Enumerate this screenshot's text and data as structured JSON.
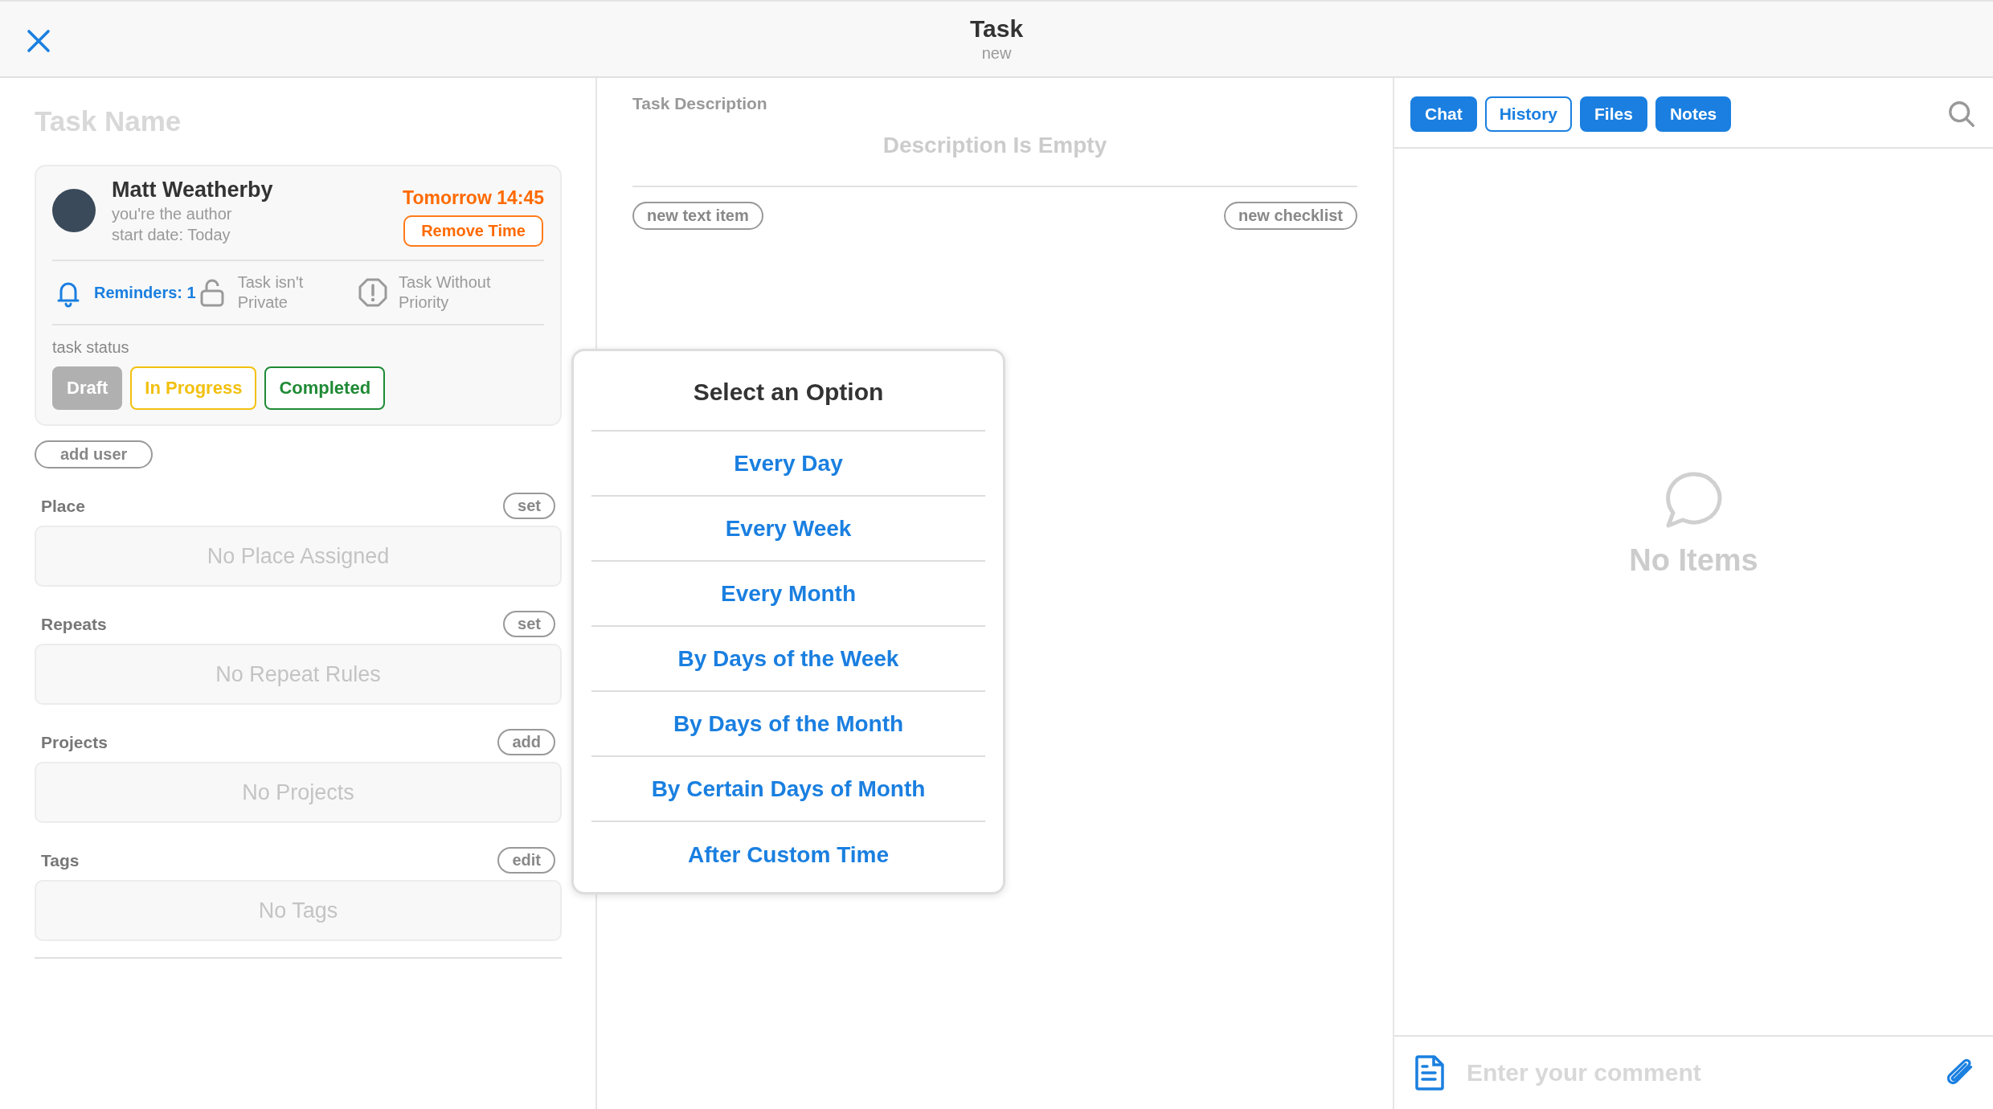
{
  "header": {
    "title": "Task",
    "subtitle": "new"
  },
  "task": {
    "name_placeholder": "Task Name",
    "author": {
      "name": "Matt Weatherby",
      "role": "you're the author",
      "start": "start date: Today"
    },
    "due": "Tomorrow 14:45",
    "remove_time": "Remove Time",
    "flags": [
      {
        "kind": "bell",
        "label": "Reminders: 1",
        "active": true
      },
      {
        "kind": "lock",
        "label": "Task isn't Private",
        "active": false
      },
      {
        "kind": "priority",
        "label": "Task Without Priority",
        "active": false
      }
    ],
    "status_label": "task status",
    "statuses": [
      {
        "label": "Draft",
        "selected": true,
        "color": "#b0b0b0"
      },
      {
        "label": "In Progress",
        "selected": false,
        "color": "#f2c00f"
      },
      {
        "label": "Completed",
        "selected": false,
        "color": "#1f8a35"
      }
    ],
    "add_user": "add user"
  },
  "sections": [
    {
      "label": "Place",
      "action": "set",
      "empty": "No Place Assigned"
    },
    {
      "label": "Repeats",
      "action": "set",
      "empty": "No Repeat Rules"
    },
    {
      "label": "Projects",
      "action": "add",
      "empty": "No Projects"
    },
    {
      "label": "Tags",
      "action": "edit",
      "empty": "No Tags"
    }
  ],
  "description": {
    "label": "Task Description",
    "empty": "Description Is Empty",
    "buttons": [
      "new text item",
      "new checklist"
    ]
  },
  "popup": {
    "title": "Select an Option",
    "options": [
      "Every Day",
      "Every Week",
      "Every Month",
      "By Days of the Week",
      "By Days of the Month",
      "By Certain Days of Month",
      "After Custom Time"
    ]
  },
  "tabs": [
    {
      "label": "Chat",
      "selected": false
    },
    {
      "label": "History",
      "selected": true
    },
    {
      "label": "Files",
      "selected": false
    },
    {
      "label": "Notes",
      "selected": false
    }
  ],
  "chat": {
    "empty": "No Items",
    "placeholder": "Enter your comment"
  }
}
